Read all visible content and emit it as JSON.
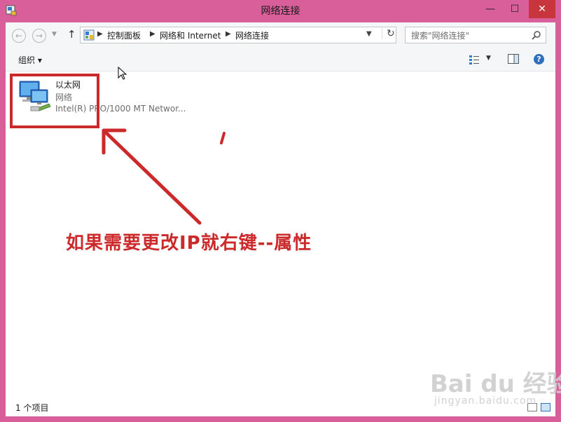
{
  "window": {
    "title": "网络连接",
    "minimize_glyph": "—",
    "maximize_glyph": "☐",
    "close_glyph": "✕"
  },
  "nav": {
    "back_glyph": "←",
    "forward_glyph": "→",
    "history_drop_glyph": "▼",
    "up_glyph": "↑"
  },
  "address": {
    "breadcrumb": [
      "控制面板",
      "网络和 Internet",
      "网络连接"
    ],
    "separator": "▶",
    "drop_glyph": "▼",
    "refresh_glyph": "↻"
  },
  "search": {
    "placeholder": "搜索\"网络连接\""
  },
  "toolbar": {
    "organize_label": "组织 ▾",
    "view_drop_glyph": "▼",
    "help_glyph": "?"
  },
  "items": [
    {
      "name": "以太网",
      "network": "网络",
      "adapter": "Intel(R) PRO/1000 MT Networ..."
    }
  ],
  "annotation": {
    "text": "如果需要更改IP就右键--属性",
    "color": "#cc2a2a"
  },
  "watermark": {
    "logo": "Bai du 经验",
    "url": "jingyan.baidu.com"
  },
  "status": {
    "count_text": "1 个项目"
  },
  "colors": {
    "frame": "#d95f9b",
    "close_button": "#c8353d",
    "accent_blue": "#2f6fbe"
  }
}
